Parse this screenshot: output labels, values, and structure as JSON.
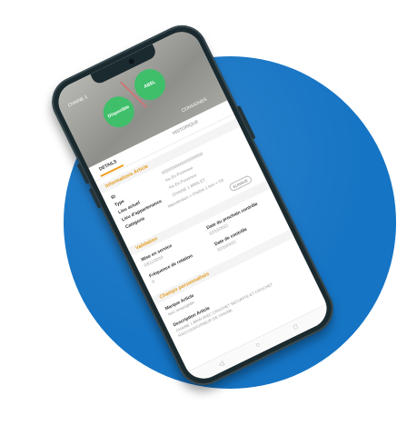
{
  "screen": {
    "header": {
      "top_label": "CHAINE 1",
      "bubble_left": "Disponible",
      "bubble_right": "ABEL",
      "right_label": "CONSIGNES"
    },
    "tabs": {
      "active": "DETAILS",
      "other": "HISTORIQUE"
    },
    "article_section": {
      "title": "Informations Article",
      "rows": [
        {
          "label": "ID",
          "value": "00000000000000000000"
        },
        {
          "label": "Type",
          "value": "Aix En Provence"
        },
        {
          "label": "Lieu actuel",
          "value": "Aix En Provence"
        },
        {
          "label": "Lieu d'appartenance",
          "value": "CHAINE 1 BRIN ET"
        },
        {
          "label": "Catégorie",
          "value": "Manutention > Chaîne 1 brin > C8"
        }
      ],
      "badge": "ELINGUE"
    },
    "validation_section": {
      "title": "Validation",
      "mise_label": "Mise en service",
      "mise_value": "03/12/2019",
      "prochain_label": "Date du prochain contrôle",
      "prochain_value": "02/10/2022",
      "frequence_label": "Fréquence de rotation",
      "frequence_value": "6",
      "controle_label": "Date de contrôle",
      "controle_value": "02/10/2021"
    },
    "custom_section": {
      "title": "Champs personnalisés",
      "marque_label": "Marque Article",
      "marque_value": "Non renseignée",
      "description_label": "Description Article",
      "description_value": "CHAINE 1 BRIN AVEC CROCHET SECURITE ET CROCHET RACCOURCISSEUR DE CHAINE"
    },
    "navbar": {
      "back_icon": "◁",
      "home_icon": "○",
      "recent_icon": "□"
    }
  },
  "colors": {
    "circle": "#1574c4",
    "accent": "#e39b1d",
    "bubble": "#3fbf6a"
  }
}
